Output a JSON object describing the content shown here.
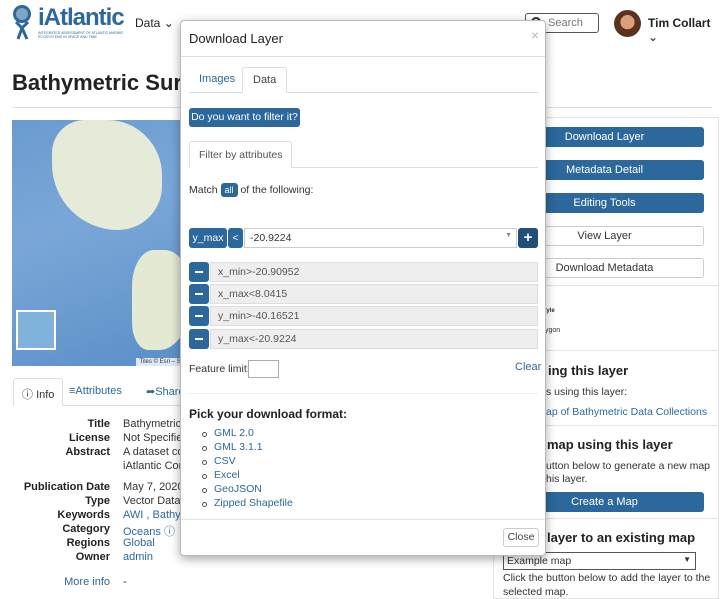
{
  "header": {
    "logo_text": "iAtlantic",
    "logo_subtitle": "INTEGRATED ASSESSMENT OF ATLANTIC MARINE ECOSYSTEMS IN SPACE AND TIME",
    "nav": [
      {
        "label": "Data"
      }
    ],
    "search_placeholder": "Search",
    "user": "Tim Collart"
  },
  "page": {
    "title": "Bathymetric Surve"
  },
  "map": {
    "attribution": "Tiles © Esri – So"
  },
  "tabs": [
    {
      "label": "Info",
      "icon": "info-icon"
    },
    {
      "label": "Attributes",
      "icon": "list-icon"
    },
    {
      "label": "Share",
      "icon": "share-icon"
    }
  ],
  "info": {
    "rows": [
      {
        "label": "Title",
        "value": "Bathymetric"
      },
      {
        "label": "License",
        "value": "Not Specified"
      },
      {
        "label": "Abstract",
        "value": "A dataset cor"
      },
      {
        "label": "",
        "value": "iAtlantic Con"
      },
      {
        "label": "Publication Date",
        "value": "May 7, 2020,"
      },
      {
        "label": "Type",
        "value": "Vector Data"
      },
      {
        "label": "Keywords",
        "value": "AWI , Bathym"
      },
      {
        "label": "Category",
        "value": "Oceans"
      },
      {
        "label": "Regions",
        "value": "Global"
      },
      {
        "label": "Owner",
        "value": "admin"
      }
    ],
    "more_info": "More info",
    "more_info_value": "-"
  },
  "right": {
    "buttons": [
      "Download Layer",
      "Metadata Detail",
      "Editing Tools",
      "View Layer",
      "Download Metadata"
    ],
    "style_fragment": "style",
    "type_fragment": "ygon",
    "maps_heading": "ing this layer",
    "maps_text": "s using this layer:",
    "maps_link": "ap of Bathymetric Data Collections",
    "create_heading": "map using this layer",
    "create_text1": "utton below to generate a new map",
    "create_text2": "his layer.",
    "create_button": "Create a Map",
    "add_heading": "layer to an existing map",
    "select_value": "Example map",
    "add_text1": "Click the button below to add the layer to the",
    "add_text2": "selected map."
  },
  "modal": {
    "title": "Download Layer",
    "close_glyph": "×",
    "tabs": [
      "Images",
      "Data"
    ],
    "active_tab": "Data",
    "filter_button": "Do you want to filter it?",
    "subtab": "Filter by attributes",
    "match_prefix": "Match",
    "match_value": "all",
    "match_suffix": "of the following:",
    "new_filter": {
      "attribute": "y_max",
      "operator": "<",
      "value": "-20.9224"
    },
    "filters": [
      "x_min>-20.90952",
      "x_max<8.0415",
      "y_min>-40.16521",
      "y_max<-20.9224"
    ],
    "feature_limit_label": "Feature limit:",
    "feature_limit_value": "",
    "clear": "Clear",
    "formats_heading": "Pick your download format:",
    "formats": [
      "GML 2.0",
      "GML 3.1.1",
      "CSV",
      "Excel",
      "GeoJSON",
      "Zipped Shapefile"
    ],
    "close_button": "Close"
  },
  "colors": {
    "primary": "#2c689c",
    "link": "#2c689c"
  }
}
